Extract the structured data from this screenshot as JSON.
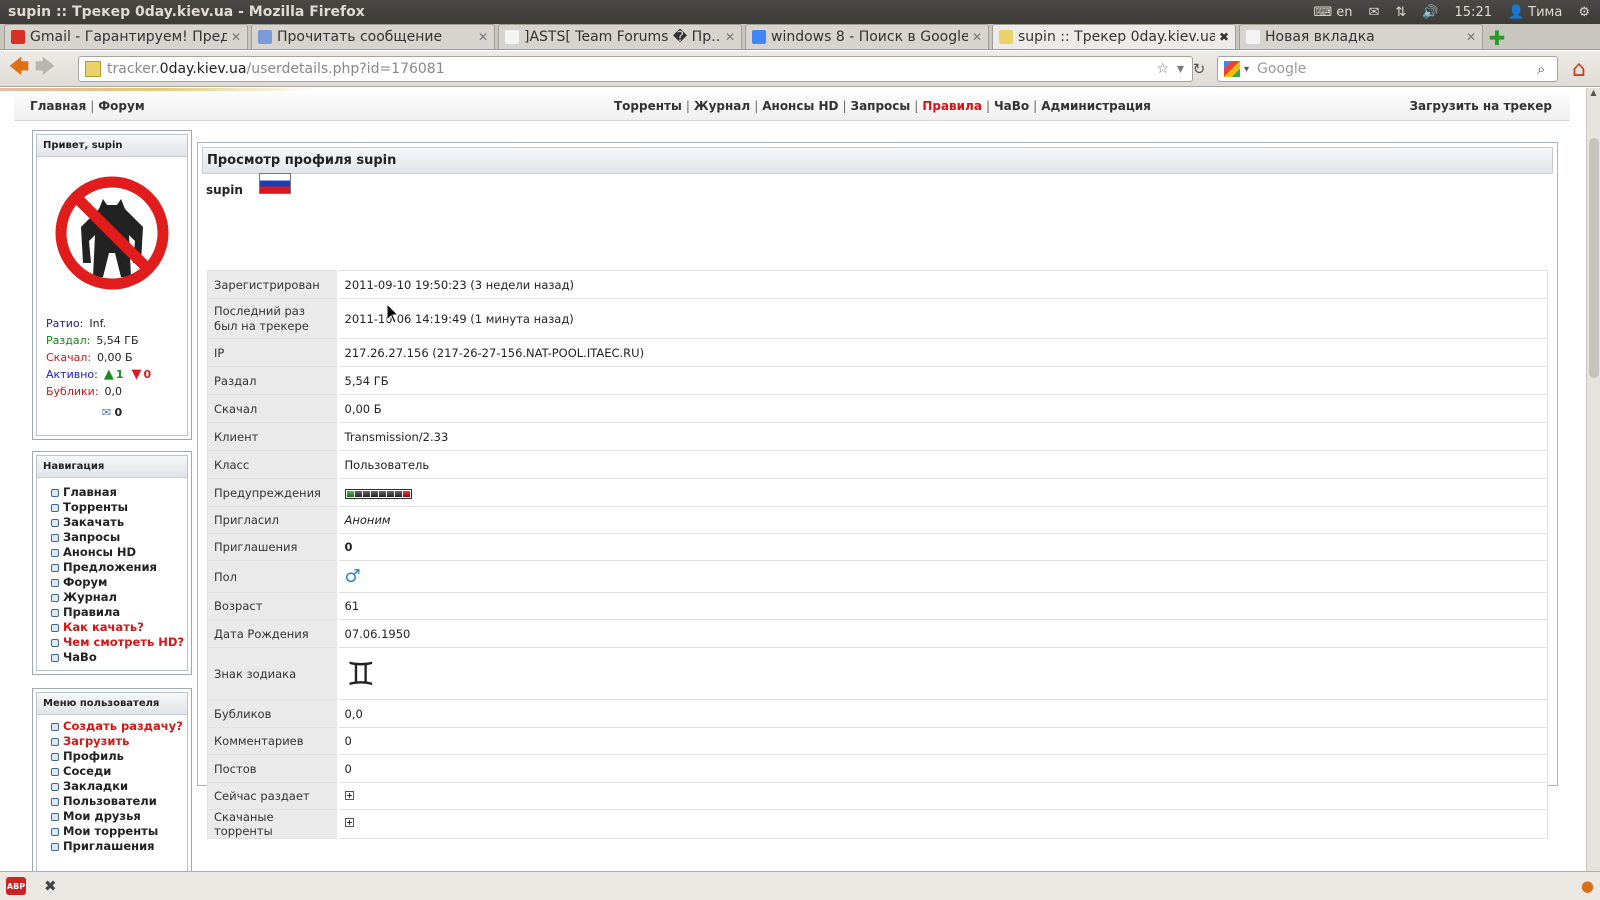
{
  "window": {
    "title": "supin :: Трекер 0day.kiev.ua - Mozilla Firefox",
    "tray": {
      "keyboard": "en",
      "time": "15:21",
      "user": "Тима"
    }
  },
  "tabs": [
    {
      "label": "Gmail - Гарантируем! Пред…",
      "color": "#d93025"
    },
    {
      "label": "Прочитать сообщение",
      "color": "#7a9bd8"
    },
    {
      "label": "]ASTS[ Team Forums � Пр…",
      "color": "#f3f3f3"
    },
    {
      "label": "windows 8 - Поиск в Google",
      "color": "#4285f4"
    },
    {
      "label": "supin :: Трекер 0day.kiev.ua",
      "color": "#e9d26a"
    },
    {
      "label": "Новая вкладка",
      "color": "#f3f3f3"
    }
  ],
  "addressbar": {
    "prefix": "tracker.",
    "domain": "0day.kiev.ua",
    "path": "/userdetails.php?id=176081"
  },
  "search": {
    "placeholder": "Google"
  },
  "topnav": {
    "home": "Главная",
    "forum": "Форум",
    "torrents": "Торренты",
    "journal": "Журнал",
    "hd": "Анонсы HD",
    "requests": "Запросы",
    "rules": "Правила",
    "faq": "ЧаВо",
    "admin": "Администрация",
    "upload": "Загрузить на трекер"
  },
  "sidebar": {
    "hello_prefix": "Привет,",
    "username": "supin",
    "stats": {
      "ratio_label": "Ратио:",
      "ratio": "Inf.",
      "up_label": "Раздал:",
      "up": "5,54 ГБ",
      "down_label": "Скачал:",
      "down": "0,00 Б",
      "active_label": "Активно:",
      "active_up": "1",
      "active_down": "0",
      "bonus_label": "Бублики:",
      "bonus": "0,0",
      "messages": "0"
    },
    "colors": {
      "ratio": "#1919b5",
      "up": "#168516",
      "down": "#c21a1a",
      "active": "#1a1ac2",
      "bonus": "#c21a1a"
    },
    "nav_title": "Навигация",
    "nav": [
      "Главная",
      "Торренты",
      "Закачать",
      "Запросы",
      "Анонсы HD",
      "Предложения",
      "Форум",
      "Журнал",
      "Правила",
      "Как качать?",
      "Чем смотреть HD?",
      "ЧаВо"
    ],
    "nav_red": [
      9,
      10
    ],
    "usermenu_title": "Меню пользователя",
    "usermenu": [
      "Создать раздачу?",
      "Загрузить",
      "Профиль",
      "Соседи",
      "Закладки",
      "Пользователи",
      "Мои друзья",
      "Мои торренты",
      "Приглашения"
    ],
    "usermenu_red": [
      0,
      1
    ]
  },
  "profile": {
    "title": "Просмотр профиля supin",
    "username": "supin",
    "rows": {
      "registered": {
        "k": "Зарегистрирован",
        "v": "2011-09-10 19:50:23 (3 недели назад)"
      },
      "lastseen": {
        "k": "Последний раз был на трекере",
        "v": "2011-10-06 14:19:49 (1 минута назад)"
      },
      "ip": {
        "k": "IP",
        "v": "217.26.27.156 (217-26-27-156.NAT-POOL.ITAEC.RU)"
      },
      "uploaded": {
        "k": "Раздал",
        "v": "5,54 ГБ"
      },
      "downloaded": {
        "k": "Скачал",
        "v": "0,00 Б"
      },
      "client": {
        "k": "Клиент",
        "v": "Transmission/2.33"
      },
      "class": {
        "k": "Класс",
        "v": "Пользователь"
      },
      "warnings": {
        "k": "Предупреждения"
      },
      "invitedby": {
        "k": "Пригласил",
        "v": "Аноним"
      },
      "invites": {
        "k": "Приглашения",
        "v": "0"
      },
      "gender": {
        "k": "Пол",
        "v": "♂"
      },
      "age": {
        "k": "Возраст",
        "v": "61"
      },
      "birthday": {
        "k": "Дата Рождения",
        "v": "07.06.1950"
      },
      "zodiac": {
        "k": "Знак зодиака",
        "v": "♊"
      },
      "bonus": {
        "k": "Бубликов",
        "v": "0,0"
      },
      "comments": {
        "k": "Комментариев",
        "v": "0"
      },
      "posts": {
        "k": "Постов",
        "v": "0"
      },
      "seeding": {
        "k": "Сейчас раздает"
      },
      "downloaded_torrents": {
        "k": "Скачаные торренты"
      }
    }
  }
}
